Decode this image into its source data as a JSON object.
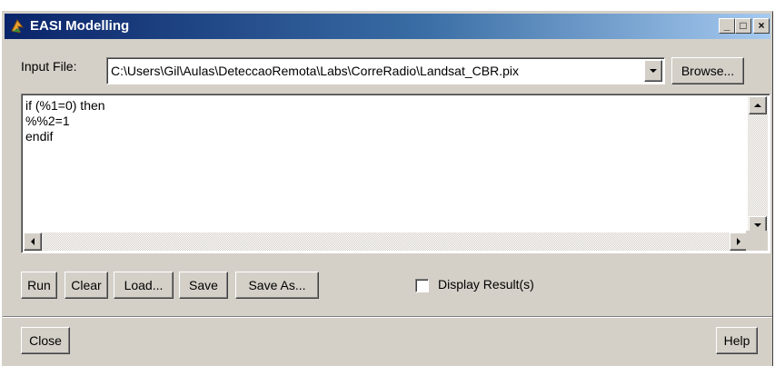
{
  "window": {
    "title": "EASI Modelling",
    "controls": {
      "minimize": "_",
      "maximize": "□",
      "close": "×"
    }
  },
  "input_file": {
    "label": "Input File:",
    "value": "C:\\Users\\Gil\\Aulas\\DeteccaoRemota\\Labs\\CorreRadio\\Landsat_CBR.pix",
    "browse_label": "Browse..."
  },
  "editor": {
    "text": "if (%1=0) then\n%%2=1\nendif"
  },
  "toolbar": {
    "run_label": "Run",
    "clear_label": "Clear",
    "load_label": "Load...",
    "save_label": "Save",
    "save_as_label": "Save As..."
  },
  "display_result": {
    "label": "Display Result(s)",
    "checked": false
  },
  "footer": {
    "close_label": "Close",
    "help_label": "Help"
  },
  "colors": {
    "title_start": "#0a246a",
    "title_end": "#a6caf0",
    "face": "#d4d0c8"
  },
  "icons": [
    "app-icon",
    "minimize-icon",
    "maximize-icon",
    "close-icon",
    "dropdown-arrow-icon",
    "scroll-up-icon",
    "scroll-down-icon",
    "scroll-left-icon",
    "scroll-right-icon"
  ]
}
